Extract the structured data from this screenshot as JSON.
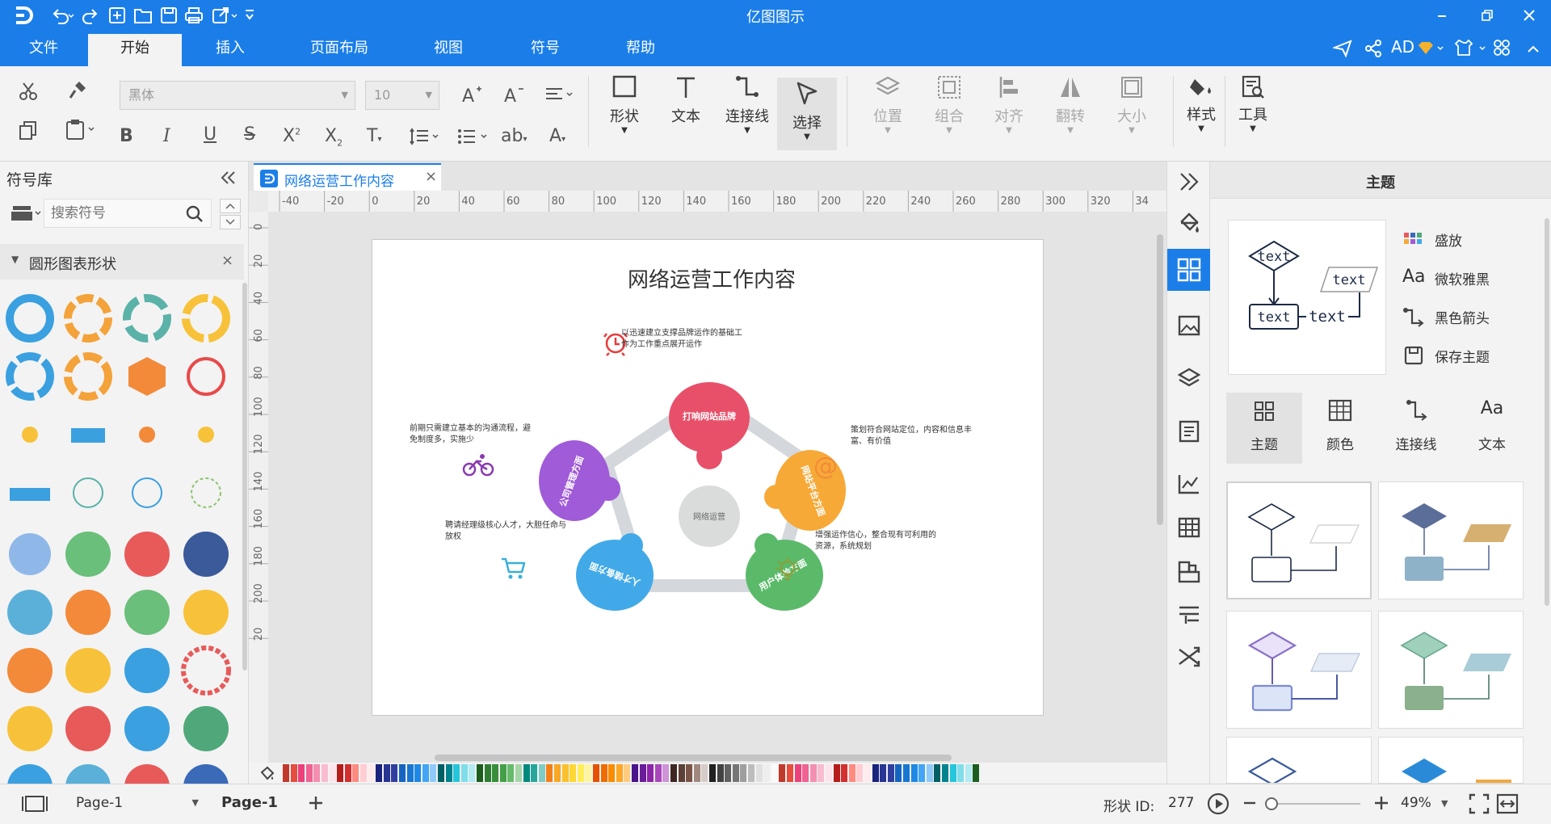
{
  "app": {
    "title": "亿图图示"
  },
  "menu": {
    "tabs": [
      {
        "label": "文件"
      },
      {
        "label": "开始"
      },
      {
        "label": "插入"
      },
      {
        "label": "页面布局"
      },
      {
        "label": "视图"
      },
      {
        "label": "符号"
      },
      {
        "label": "帮助"
      }
    ],
    "user": "AD"
  },
  "ribbon": {
    "font_family": "黑体",
    "font_size": "10",
    "big_buttons": [
      {
        "label": "形状"
      },
      {
        "label": "文本"
      },
      {
        "label": "连接线"
      },
      {
        "label": "选择"
      },
      {
        "label": "位置"
      },
      {
        "label": "组合"
      },
      {
        "label": "对齐"
      },
      {
        "label": "翻转"
      },
      {
        "label": "大小"
      },
      {
        "label": "样式"
      },
      {
        "label": "工具"
      }
    ]
  },
  "library": {
    "title": "符号库",
    "search_placeholder": "搜索符号",
    "category": "圆形图表形状"
  },
  "document": {
    "tab_title": "网络运营工作内容"
  },
  "ruler": {
    "h": [
      "-40",
      "-20",
      "0",
      "20",
      "40",
      "60",
      "80",
      "100",
      "120",
      "140",
      "160",
      "180",
      "200",
      "220",
      "240",
      "260",
      "280",
      "300",
      "320",
      "34"
    ],
    "v": [
      "0",
      "20",
      "40",
      "60",
      "80",
      "100",
      "120",
      "140",
      "160",
      "180",
      "200",
      "20"
    ]
  },
  "diagram": {
    "title": "网络运营工作内容",
    "center": "网络运营",
    "pieces": [
      {
        "label": "打响网站品牌",
        "color": "#e8506a"
      },
      {
        "label": "网站平台方面",
        "color": "#f7a937"
      },
      {
        "label": "用户体验方面",
        "color": "#5aba6a"
      },
      {
        "label": "人才储备方面",
        "color": "#42a9e8"
      },
      {
        "label": "公司管理方面",
        "color": "#a05bd8"
      }
    ],
    "notes": [
      {
        "text": "以迅速建立支撑品牌运作的基础工作为工作重点展开运作",
        "lines": [
          "以迅速建立支撑品牌运作的基础工",
          "作为工作重点展开运作"
        ]
      },
      {
        "text": "策划符合网站定位，内容和信息丰富、有价值",
        "lines": [
          "策划符合网站定位，内容和信息丰",
          "富、有价值"
        ]
      },
      {
        "text": "增强运作信心，整合现有可利用的资源，系统规划",
        "lines": [
          "增强运作信心，整合现有可利用的",
          "资源，系统规划"
        ]
      },
      {
        "text": "聘请经理级核心人才，大胆任命与放权",
        "lines": [
          "聘请经理级核心人才，大胆任命与",
          "放权"
        ]
      },
      {
        "text": "前期只需建立基本的沟通流程，避免制度多，实施少",
        "lines": [
          "前期只需建立基本的沟通流程，避",
          "免制度多，实施少"
        ]
      }
    ]
  },
  "theme_panel": {
    "title": "主题",
    "preview_texts": [
      "text",
      "text",
      "text",
      "text"
    ],
    "options": [
      {
        "label": "盛放"
      },
      {
        "label": "微软雅黑"
      },
      {
        "label": "黑色箭头"
      },
      {
        "label": "保存主题"
      }
    ],
    "tabs": [
      {
        "label": "主题"
      },
      {
        "label": "颜色"
      },
      {
        "label": "连接线"
      },
      {
        "label": "文本"
      }
    ]
  },
  "status": {
    "page_selector": "Page-1",
    "page_tab": "Page-1",
    "shape_id_label": "形状 ID:",
    "shape_id": "277",
    "zoom": "49%"
  },
  "colors": {
    "accent": "#1b7ee8"
  }
}
